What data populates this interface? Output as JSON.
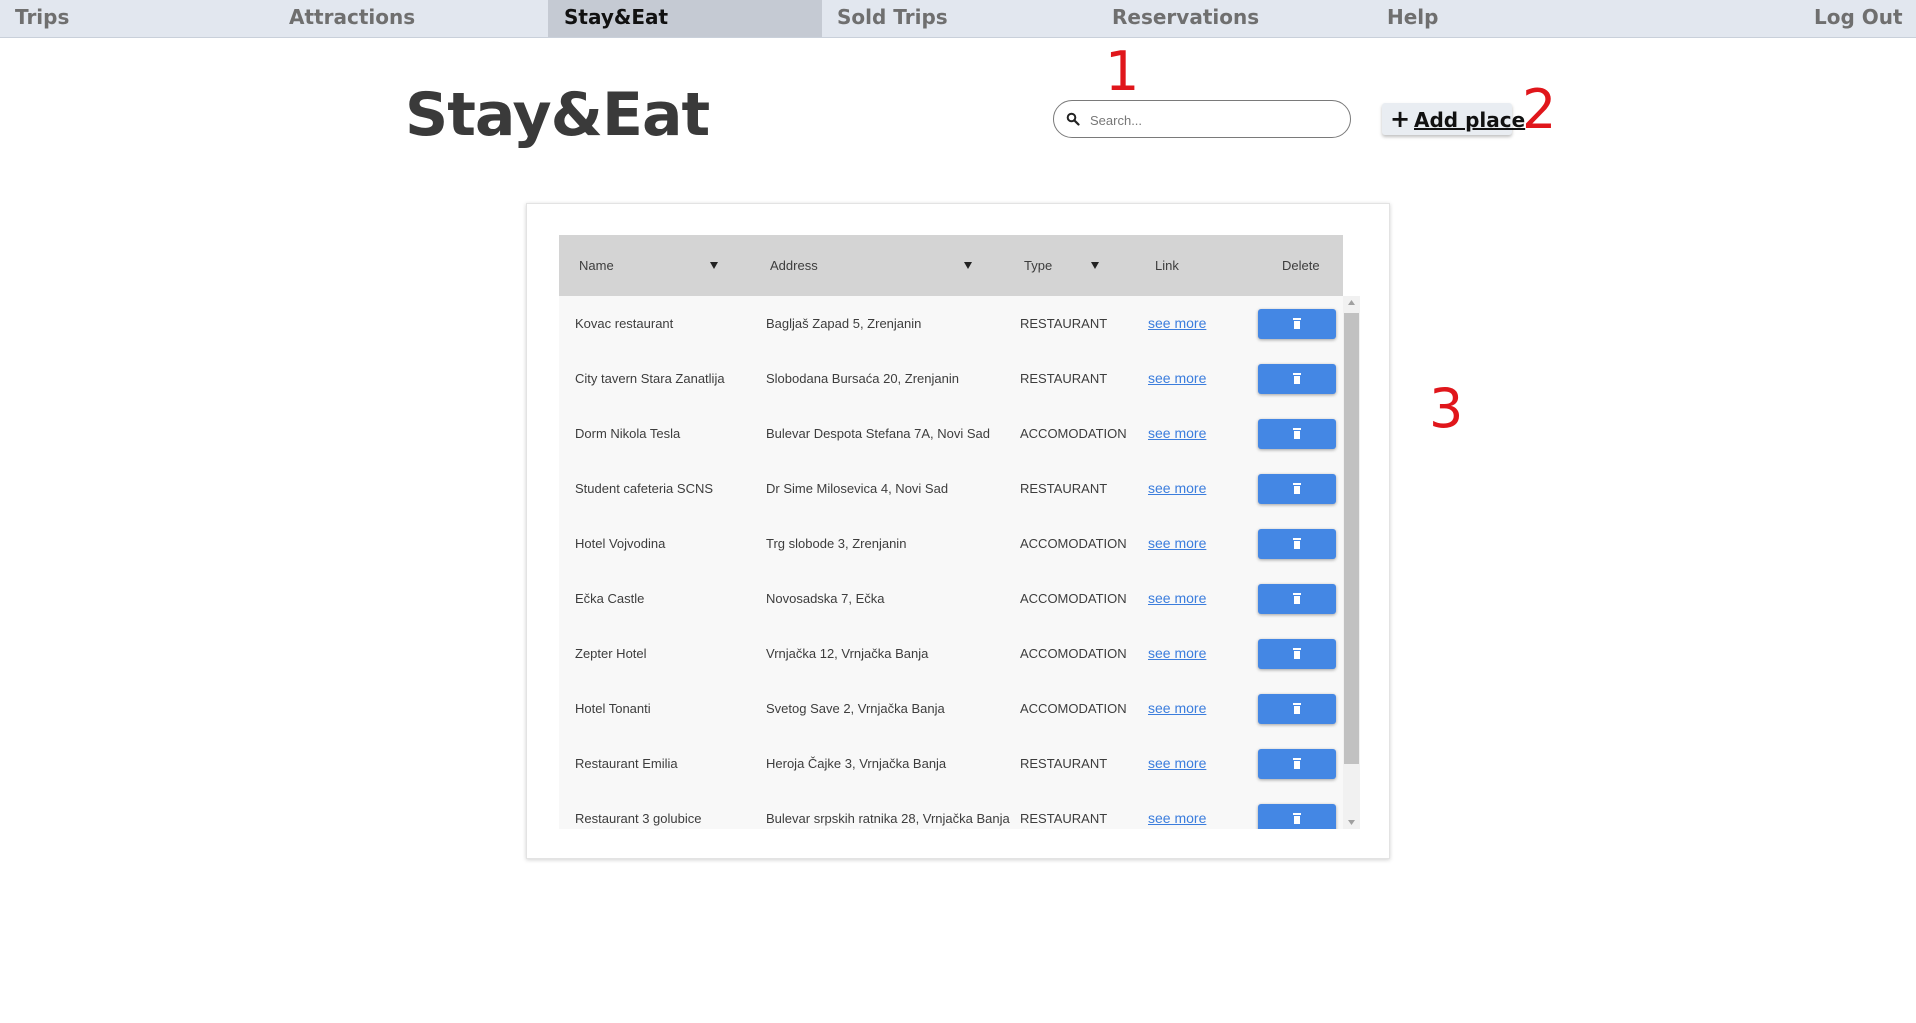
{
  "nav": {
    "items": [
      {
        "label": "Trips"
      },
      {
        "label": "Attractions"
      },
      {
        "label": "Stay&Eat"
      },
      {
        "label": "Sold Trips"
      },
      {
        "label": "Reservations"
      },
      {
        "label": "Help"
      },
      {
        "label": "Log Out"
      }
    ],
    "active": "Stay&Eat"
  },
  "header": {
    "title": "Stay&Eat",
    "search_placeholder": "Search...",
    "add_button_label": "Add place"
  },
  "annotations": [
    "1",
    "2",
    "3"
  ],
  "table": {
    "columns": [
      "Name",
      "Address",
      "Type",
      "Link",
      "Delete"
    ],
    "link_text": "see more",
    "rows": [
      {
        "name": "Kovac restaurant",
        "address": "Bagljaš Zapad 5, Zrenjanin",
        "type": "RESTAURANT"
      },
      {
        "name": "City tavern Stara Zanatlija",
        "address": "Slobodana Bursaća 20, Zrenjanin",
        "type": "RESTAURANT"
      },
      {
        "name": "Dorm Nikola Tesla",
        "address": "Bulevar Despota Stefana 7A, Novi Sad",
        "type": "ACCOMODATION"
      },
      {
        "name": "Student cafeteria SCNS",
        "address": "Dr Sime Milosevica 4, Novi Sad",
        "type": "RESTAURANT"
      },
      {
        "name": "Hotel Vojvodina",
        "address": "Trg slobode 3, Zrenjanin",
        "type": "ACCOMODATION"
      },
      {
        "name": "Ečka Castle",
        "address": "Novosadska 7, Ečka",
        "type": "ACCOMODATION"
      },
      {
        "name": "Zepter Hotel",
        "address": "Vrnjačka 12, Vrnjačka Banja",
        "type": "ACCOMODATION"
      },
      {
        "name": "Hotel Tonanti",
        "address": "Svetog Save 2, Vrnjačka Banja",
        "type": "ACCOMODATION"
      },
      {
        "name": "Restaurant Emilia",
        "address": "Heroja Čajke 3, Vrnjačka Banja",
        "type": "RESTAURANT"
      },
      {
        "name": "Restaurant 3 golubice",
        "address": "Bulevar srpskih ratnika 28, Vrnjačka Banja",
        "type": "RESTAURANT"
      }
    ]
  },
  "colors": {
    "nav_bg": "#e2e7ef",
    "nav_active_bg": "#c5cad3",
    "delete_button": "#4487e4",
    "link": "#3b7ddd",
    "annotation": "#e0161b"
  },
  "icons": {
    "search": "search-icon",
    "add": "plus-icon",
    "delete": "trash-icon",
    "sort": "sort-arrow-icon"
  }
}
